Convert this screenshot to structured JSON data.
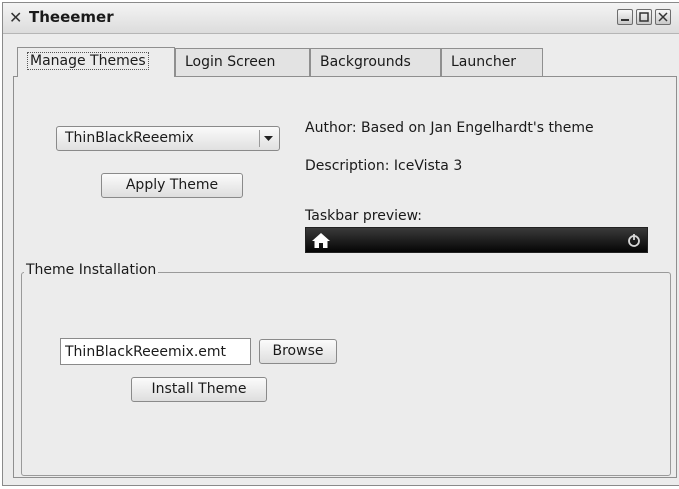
{
  "window": {
    "title": "Theeemer",
    "icon": "x-cross-icon",
    "controls": [
      "minimize-icon",
      "maximize-icon",
      "close-icon"
    ]
  },
  "tabs": [
    {
      "label": "Manage Themes",
      "active": true
    },
    {
      "label": "Login Screen",
      "active": false
    },
    {
      "label": "Backgrounds",
      "active": false
    },
    {
      "label": "Launcher",
      "active": false
    }
  ],
  "manage": {
    "theme_select": {
      "selected": "ThinBlackReeemix"
    },
    "apply_button": "Apply Theme",
    "author": "Author: Based on Jan Engelhardt's theme",
    "description": "Description: IceVista 3",
    "taskbar_label": "Taskbar preview:",
    "taskbar_icons": [
      "home-icon",
      "power-icon"
    ]
  },
  "installation": {
    "group_title": "Theme Installation",
    "file_value": "ThinBlackReeemix.emt",
    "browse_button": "Browse",
    "install_button": "Install Theme"
  }
}
